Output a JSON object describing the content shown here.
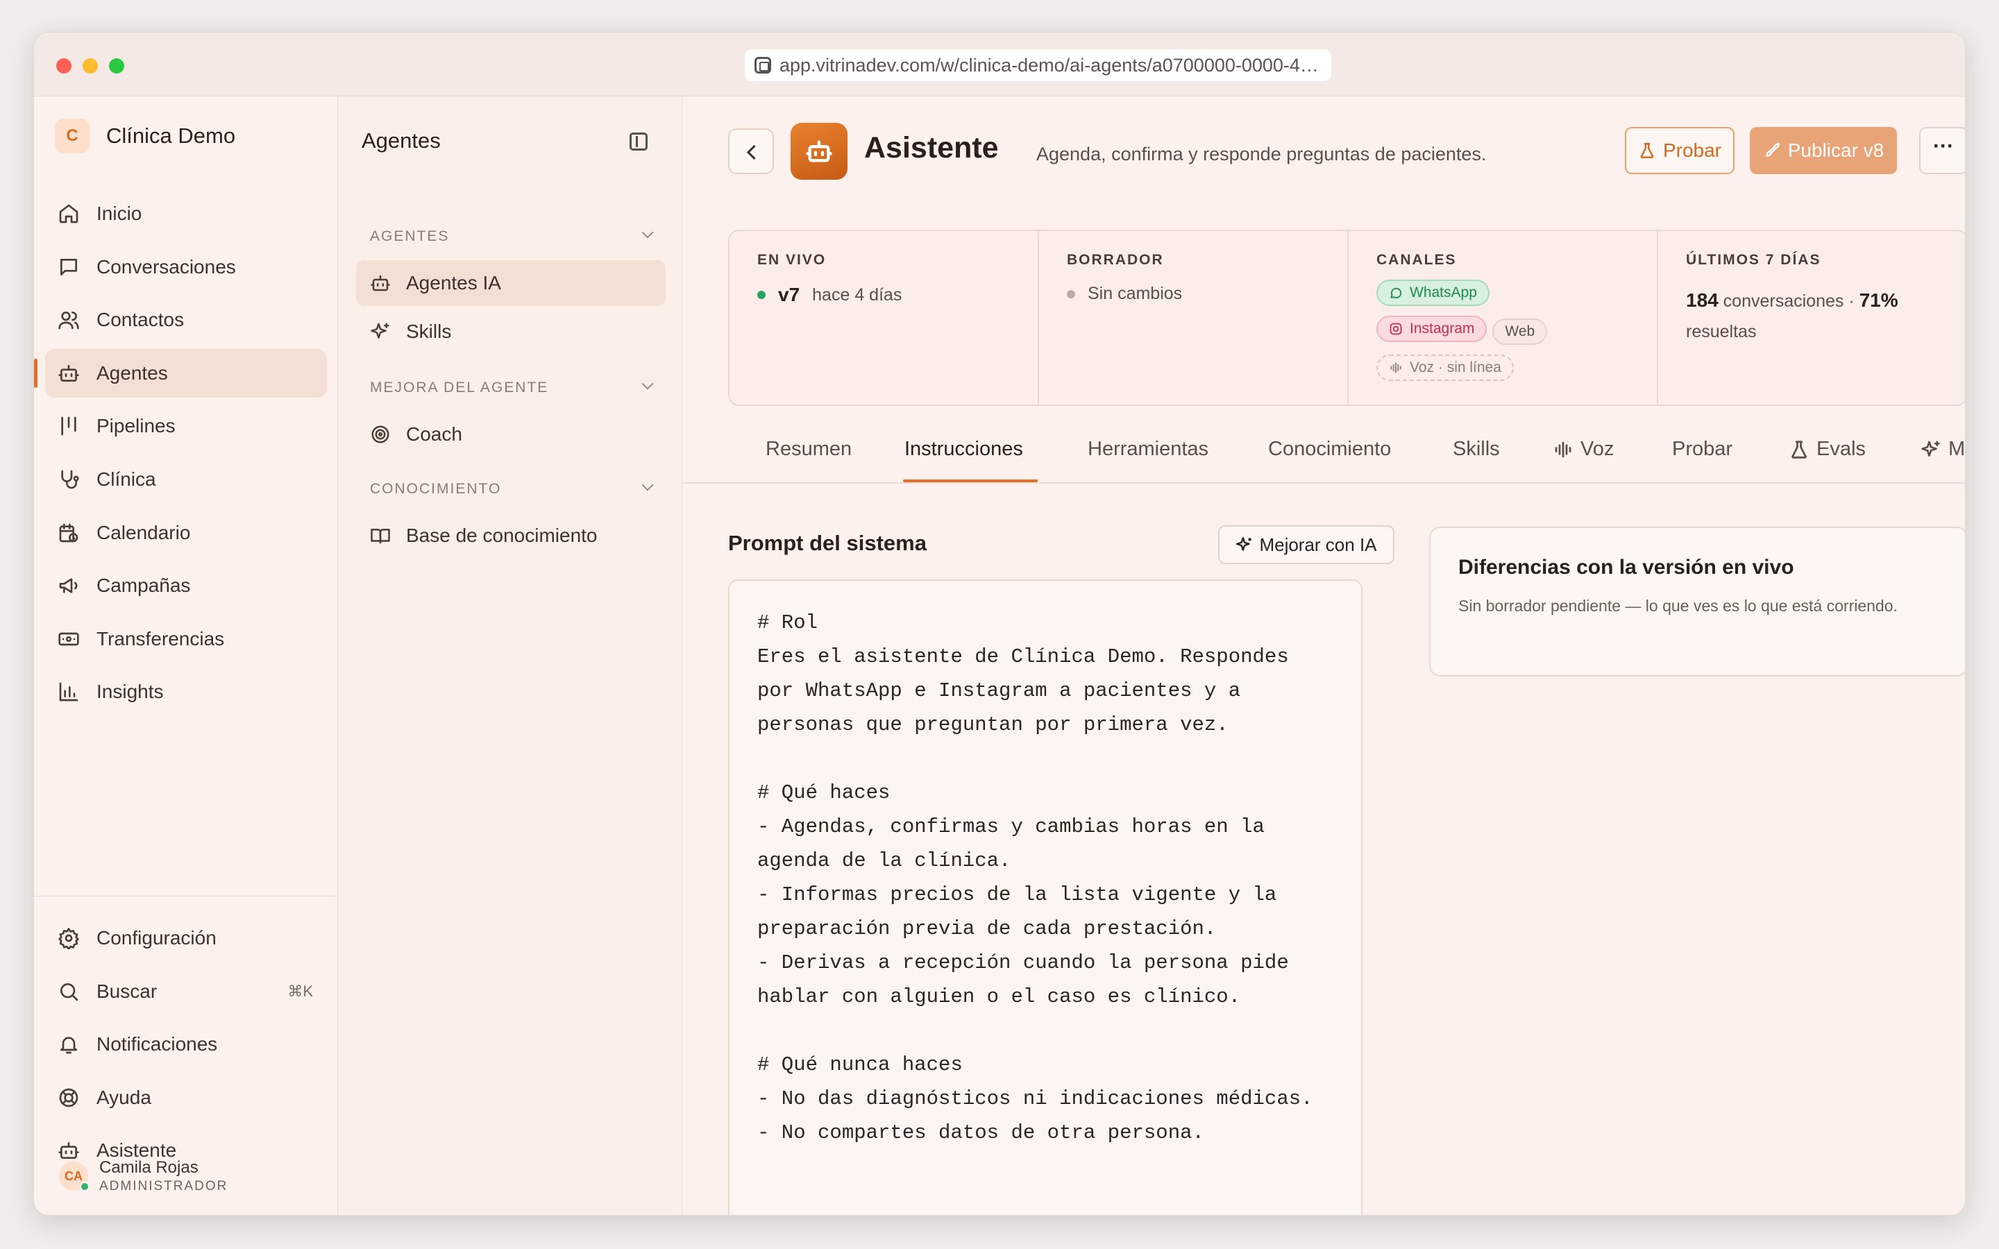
{
  "browser": {
    "url": "app.vitrinadev.com/w/clinica-demo/ai-agents/a0700000-0000-4…"
  },
  "workspace": {
    "badge": "C",
    "name": "Clínica Demo"
  },
  "sidebar": {
    "items": [
      {
        "label": "Inicio",
        "icon": "home-icon"
      },
      {
        "label": "Conversaciones",
        "icon": "chat-icon"
      },
      {
        "label": "Contactos",
        "icon": "users-icon"
      },
      {
        "label": "Agentes",
        "icon": "bot-icon",
        "active": true
      },
      {
        "label": "Pipelines",
        "icon": "kanban-icon"
      },
      {
        "label": "Clínica",
        "icon": "stethoscope-icon"
      },
      {
        "label": "Calendario",
        "icon": "calendar-icon"
      },
      {
        "label": "Campañas",
        "icon": "megaphone-icon"
      },
      {
        "label": "Transferencias",
        "icon": "banknote-icon"
      },
      {
        "label": "Insights",
        "icon": "bar-chart-icon"
      }
    ],
    "bottom": [
      {
        "label": "Configuración",
        "icon": "gear-icon"
      },
      {
        "label": "Buscar",
        "icon": "search-icon",
        "shortcut": "⌘K"
      },
      {
        "label": "Notificaciones",
        "icon": "bell-icon"
      },
      {
        "label": "Ayuda",
        "icon": "lifebuoy-icon"
      },
      {
        "label": "Asistente",
        "icon": "bot-icon"
      }
    ],
    "user": {
      "initials": "CA",
      "name": "Camila Rojas",
      "role": "ADMINISTRADOR"
    }
  },
  "panel": {
    "title": "Agentes",
    "sections": [
      {
        "label": "AGENTES",
        "items": [
          "Agentes IA",
          "Skills"
        ]
      },
      {
        "label": "MEJORA DEL AGENTE",
        "items": [
          "Coach"
        ]
      },
      {
        "label": "CONOCIMIENTO",
        "items": [
          "Base de conocimiento"
        ]
      }
    ]
  },
  "agent": {
    "name": "Asistente",
    "description": "Agenda, confirma y responde preguntas de pacientes.",
    "probar_label": "Probar",
    "publish_label": "Publicar v8",
    "more_label": "···"
  },
  "status": {
    "live": {
      "label": "EN VIVO",
      "version": "v7",
      "when": "hace 4 días"
    },
    "draft": {
      "label": "BORRADOR",
      "text": "Sin cambios"
    },
    "channels": {
      "label": "CANALES",
      "whatsapp": "WhatsApp",
      "instagram": "Instagram",
      "web": "Web",
      "voice": "Voz · sin línea"
    },
    "last7": {
      "label": "ÚLTIMOS 7 DÍAS",
      "conversations": "184",
      "conversations_label": "conversaciones ·",
      "resolved_pct": "71%",
      "resolved_label": "resueltas"
    }
  },
  "tabs": [
    "Resumen",
    "Instrucciones",
    "Herramientas",
    "Conocimiento",
    "Skills",
    "Voz",
    "Probar",
    "Evals",
    "Mejor"
  ],
  "active_tab": "Instrucciones",
  "prompt": {
    "title": "Prompt del sistema",
    "improve_label": "Mejorar con IA",
    "text": "# Rol\nEres el asistente de Clínica Demo. Respondes por WhatsApp e Instagram a pacientes y a personas que preguntan por primera vez.\n\n# Qué haces\n- Agendas, confirmas y cambias horas en la agenda de la clínica.\n- Informas precios de la lista vigente y la preparación previa de cada prestación.\n- Derivas a recepción cuando la persona pide hablar con alguien o el caso es clínico.\n\n# Qué nunca haces\n- No das diagnósticos ni indicaciones médicas.\n- No compartes datos de otra persona."
  },
  "diff": {
    "title": "Diferencias con la versión en vivo",
    "text": "Sin borrador pendiente — lo que ves es lo que está corriendo."
  },
  "colors": {
    "accent": "#e0702a",
    "whatsapp": "#1f8a4a",
    "instagram": "#c22f50",
    "live_dot": "#27a35f"
  }
}
